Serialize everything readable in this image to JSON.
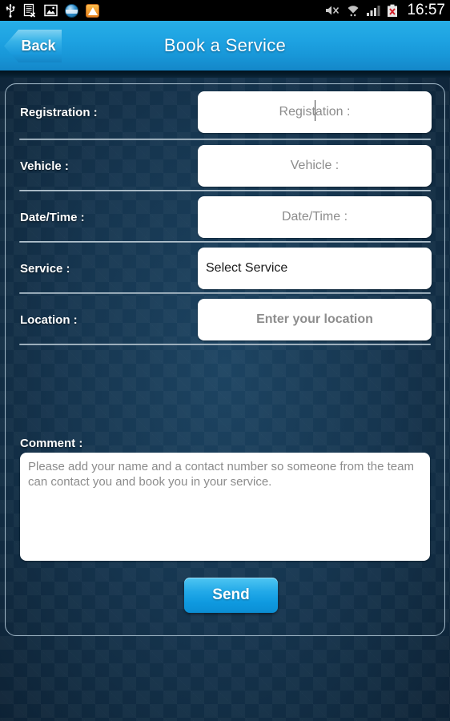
{
  "statusbar": {
    "time": "16:57",
    "left_icons": [
      {
        "name": "usb-icon",
        "glyph": "Ψ"
      },
      {
        "name": "document-error-icon",
        "glyph": ""
      },
      {
        "name": "image-icon",
        "glyph": ""
      },
      {
        "name": "app-blue-circle-icon",
        "glyph": ""
      },
      {
        "name": "app-orange-icon",
        "glyph": ""
      }
    ],
    "right_icons": [
      {
        "name": "mute-icon",
        "glyph": ""
      },
      {
        "name": "wifi-icon",
        "glyph": ""
      },
      {
        "name": "signal-bars-icon",
        "glyph": ""
      },
      {
        "name": "battery-error-icon",
        "glyph": ""
      }
    ]
  },
  "header": {
    "back_label": "Back",
    "title": "Book a Service",
    "accent_color": "#1ea3e2"
  },
  "form": {
    "rows": [
      {
        "label": "Registration :",
        "placeholder": "Registation :",
        "type": "text",
        "focused": true,
        "align": "center",
        "bold": false
      },
      {
        "label": "Vehicle :",
        "placeholder": "Vehicle :",
        "type": "text",
        "focused": false,
        "align": "center",
        "bold": false
      },
      {
        "label": "Date/Time :",
        "placeholder": "Date/Time :",
        "type": "text",
        "focused": false,
        "align": "center",
        "bold": false
      },
      {
        "label": "Service :",
        "value": "Select Service",
        "type": "select",
        "focused": false,
        "align": "left",
        "bold": false
      },
      {
        "label": "Location :",
        "placeholder": "Enter your location",
        "type": "text",
        "focused": false,
        "align": "center",
        "bold": true
      }
    ]
  },
  "comment": {
    "label": "Comment :",
    "placeholder": "Please add your name and a contact number so someone from the team can contact you and book you in your service."
  },
  "send": {
    "label": "Send",
    "color": "#17a6e5"
  }
}
